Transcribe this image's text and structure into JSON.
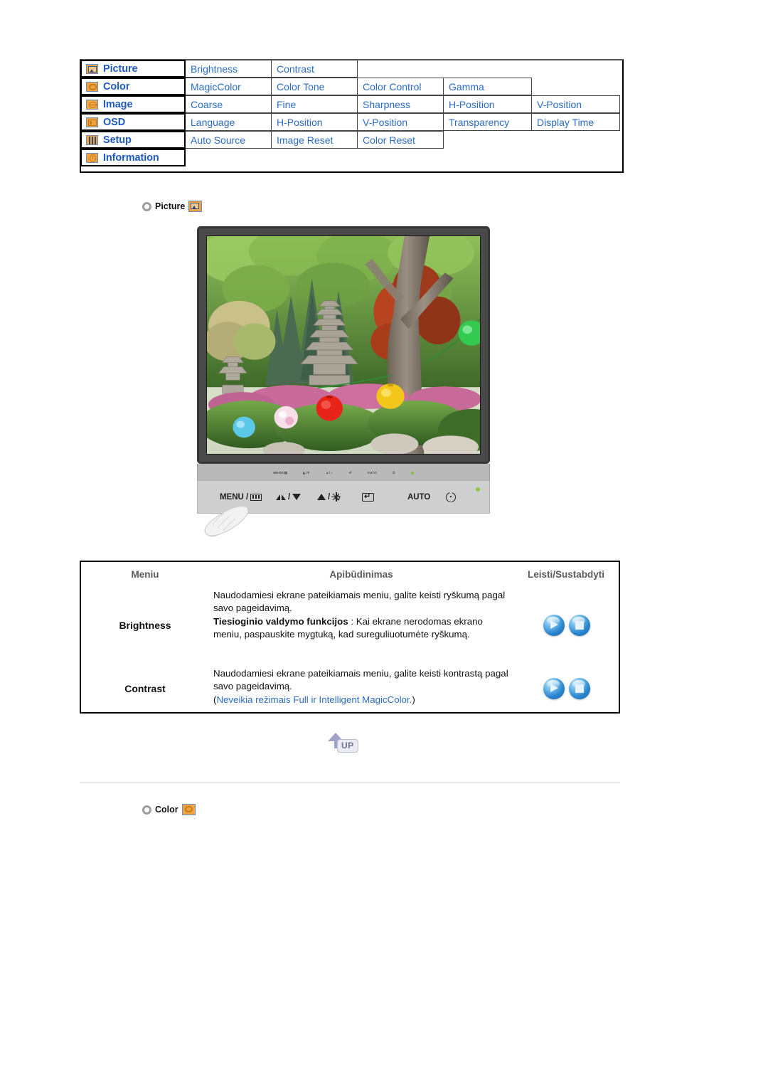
{
  "menu_map": {
    "rows": [
      {
        "category": "Picture",
        "icon": "picture-icon",
        "items": [
          "Brightness",
          "Contrast"
        ]
      },
      {
        "category": "Color",
        "icon": "color-palette-icon",
        "items": [
          "MagicColor",
          "Color Tone",
          "Color Control",
          "Gamma"
        ]
      },
      {
        "category": "Image",
        "icon": "image-icon",
        "items": [
          "Coarse",
          "Fine",
          "Sharpness",
          "H-Position",
          "V-Position"
        ]
      },
      {
        "category": "OSD",
        "icon": "osd-icon",
        "items": [
          "Language",
          "H-Position",
          "V-Position",
          "Transparency",
          "Display Time"
        ]
      },
      {
        "category": "Setup",
        "icon": "setup-sliders-icon",
        "items": [
          "Auto Source",
          "Image Reset",
          "Color Reset"
        ]
      },
      {
        "category": "Information",
        "icon": "information-icon",
        "items": []
      }
    ]
  },
  "sections": [
    {
      "title": "Picture",
      "icon": "picture-icon"
    },
    {
      "title": "Color",
      "icon": "color-palette-icon"
    }
  ],
  "monitor": {
    "controls": [
      {
        "label": "MENU /",
        "glyph": "menu-bars-icon"
      },
      {
        "label": "/",
        "glyph": "magicbright-down-icon"
      },
      {
        "label": "/",
        "glyph": "up-brightness-icon"
      },
      {
        "label": "",
        "glyph": "enter-icon"
      },
      {
        "label": "AUTO",
        "glyph": ""
      },
      {
        "label": "",
        "glyph": "power-icon"
      }
    ],
    "bezel_mini_labels": [
      "MENU /",
      "/",
      "/",
      "",
      "AUTO",
      ""
    ],
    "power_led_color": "#8ec63f"
  },
  "desc_table": {
    "headers": [
      "Meniu",
      "Apibūdinimas",
      "Leisti/Sustabdyti"
    ],
    "rows": [
      {
        "menu": "Brightness",
        "lines": [
          {
            "text": "Naudodamiesi ekrane pateikiamais meniu, galite keisti ryškumą pagal savo pageidavimą.",
            "style": "normal"
          },
          {
            "text": "Tiesioginio valdymo funkcijos",
            "style": "bold",
            "suffix": " : Kai ekrane nerodomas ekrano meniu, paspauskite mygtuką, kad sureguliuotumėte ryškumą."
          }
        ],
        "buttons": [
          "play-button",
          "stop-button"
        ]
      },
      {
        "menu": "Contrast",
        "lines": [
          {
            "text": "Naudodamiesi ekrane pateikiamais meniu, galite keisti kontrastą pagal savo pageidavimą.",
            "style": "normal"
          },
          {
            "text": "Neveikia režimais Full ir Intelligent MagicColor.",
            "style": "blue-paren"
          }
        ],
        "buttons": [
          "play-button",
          "stop-button"
        ]
      }
    ]
  },
  "up_button": {
    "label": "UP"
  },
  "colors": {
    "menu_text": "#2B6CC4",
    "category_text": "#1F5BBF",
    "header_gray": "#5a5a5a",
    "icon_orange": "#F0A441",
    "orb_blue": "#2a86cf",
    "up_violet": "#9fa3c4"
  }
}
